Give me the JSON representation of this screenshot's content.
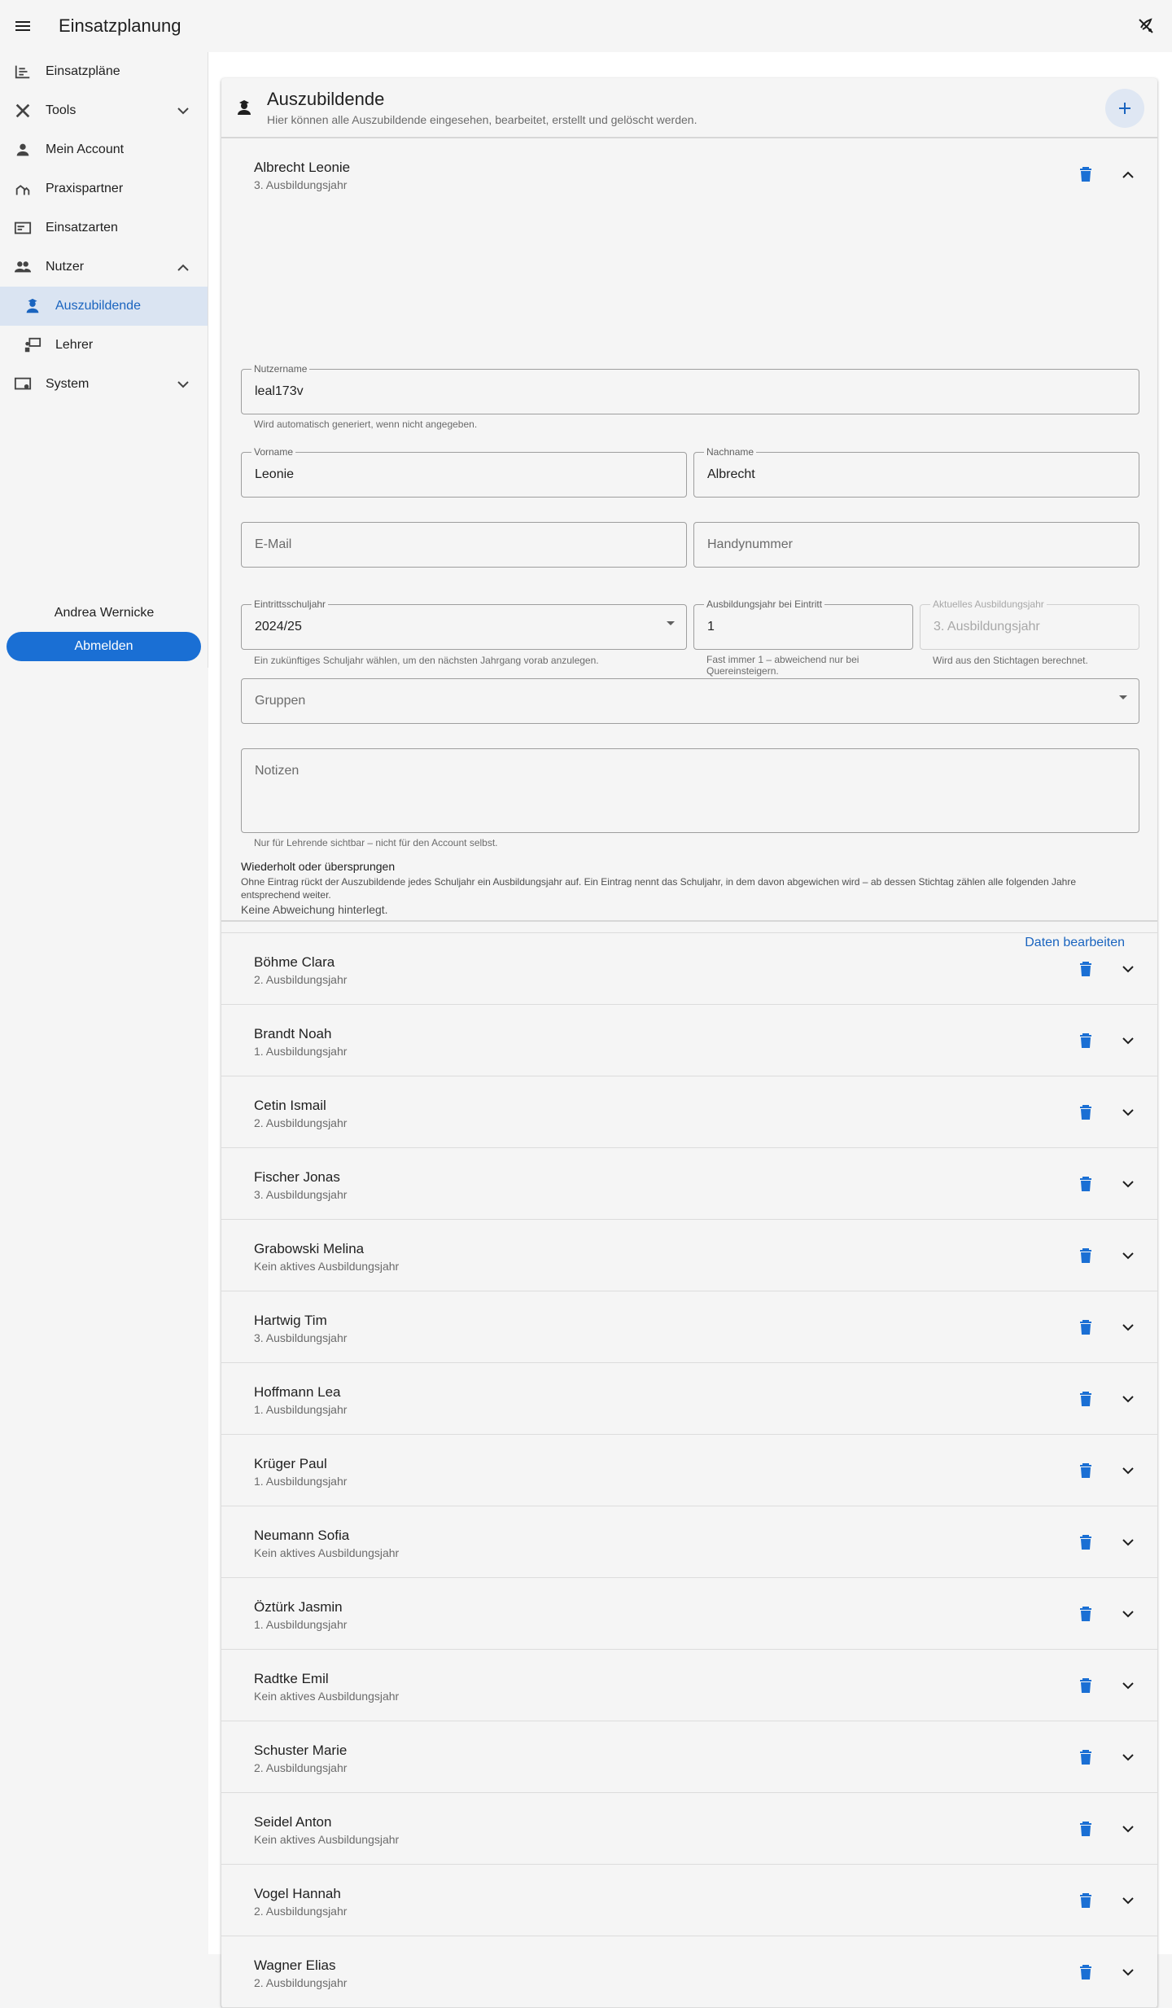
{
  "app": {
    "title": "Einsatzplanung"
  },
  "sidebar": {
    "items": [
      {
        "label": "Einsatzpläne",
        "icon": "plans-icon"
      },
      {
        "label": "Tools",
        "icon": "tools-icon"
      },
      {
        "label": "Mein Account",
        "icon": "person-icon"
      },
      {
        "label": "Praxispartner",
        "icon": "partner-icon"
      },
      {
        "label": "Einsatzarten",
        "icon": "card-icon"
      },
      {
        "label": "Nutzer",
        "icon": "group-icon"
      },
      {
        "label": "Auszubildende",
        "icon": "student-icon"
      },
      {
        "label": "Lehrer",
        "icon": "teacher-icon"
      },
      {
        "label": "System",
        "icon": "system-icon"
      }
    ],
    "user_name": "Andrea Wernicke",
    "logout_label": "Abmelden"
  },
  "panel": {
    "title": "Auszubildende",
    "subtitle": "Hier können alle Auszubildende eingesehen, bearbeitet, erstellt und gelöscht werden."
  },
  "expanded": {
    "name": "Albrecht Leonie",
    "year": "3. Ausbildungsjahr",
    "fields": {
      "username_label": "Nutzername",
      "username_value": "leal173v",
      "username_hint": "Wird automatisch generiert, wenn nicht angegeben.",
      "firstname_label": "Vorname",
      "firstname_value": "Leonie",
      "lastname_label": "Nachname",
      "lastname_value": "Albrecht",
      "email_placeholder": "E-Mail",
      "phone_placeholder": "Handynummer",
      "entry_year_label": "Eintrittsschuljahr",
      "entry_year_value": "2024/25",
      "entry_year_hint": "Ein zukünftiges Schuljahr wählen, um den nächsten Jahrgang vorab anzulegen.",
      "entry_training_label": "Ausbildungsjahr bei Eintritt",
      "entry_training_value": "1",
      "entry_training_hint": "Fast immer 1 – abweichend nur bei Quereinsteigern.",
      "current_year_label": "Aktuelles Ausbildungsjahr",
      "current_year_value": "3. Ausbildungsjahr",
      "current_year_hint": "Wird aus den Stichtagen berechnet.",
      "groups_placeholder": "Gruppen",
      "notes_placeholder": "Notizen",
      "notes_hint": "Nur für Lehrende sichtbar – nicht für den Account selbst."
    },
    "repeat_title": "Wiederholt oder übersprungen",
    "repeat_desc": "Ohne Eintrag rückt der Auszubildende jedes Schuljahr ein Ausbildungsjahr auf. Ein Eintrag nennt das Schuljahr, in dem davon abgewichen wird – ab dessen Stichtag zählen alle folgenden Jahre entsprechend weiter.",
    "repeat_none": "Keine Abweichung hinterlegt.",
    "edit_label": "Daten bearbeiten"
  },
  "students": [
    {
      "name": "Böhme Clara",
      "year": "2. Ausbildungsjahr"
    },
    {
      "name": "Brandt Noah",
      "year": "1. Ausbildungsjahr"
    },
    {
      "name": "Cetin Ismail",
      "year": "2. Ausbildungsjahr"
    },
    {
      "name": "Fischer Jonas",
      "year": "3. Ausbildungsjahr"
    },
    {
      "name": "Grabowski Melina",
      "year": "Kein aktives Ausbildungsjahr"
    },
    {
      "name": "Hartwig Tim",
      "year": "3. Ausbildungsjahr"
    },
    {
      "name": "Hoffmann Lea",
      "year": "1. Ausbildungsjahr"
    },
    {
      "name": "Krüger Paul",
      "year": "1. Ausbildungsjahr"
    },
    {
      "name": "Neumann Sofia",
      "year": "Kein aktives Ausbildungsjahr"
    },
    {
      "name": "Öztürk Jasmin",
      "year": "1. Ausbildungsjahr"
    },
    {
      "name": "Radtke Emil",
      "year": "Kein aktives Ausbildungsjahr"
    },
    {
      "name": "Schuster Marie",
      "year": "2. Ausbildungsjahr"
    },
    {
      "name": "Seidel Anton",
      "year": "Kein aktives Ausbildungsjahr"
    },
    {
      "name": "Vogel Hannah",
      "year": "2. Ausbildungsjahr"
    },
    {
      "name": "Wagner Elias",
      "year": "2. Ausbildungsjahr"
    }
  ],
  "colors": {
    "accent": "#1a6fd4",
    "active_bg": "#dae4f2",
    "delete": "#1a6fd4"
  }
}
